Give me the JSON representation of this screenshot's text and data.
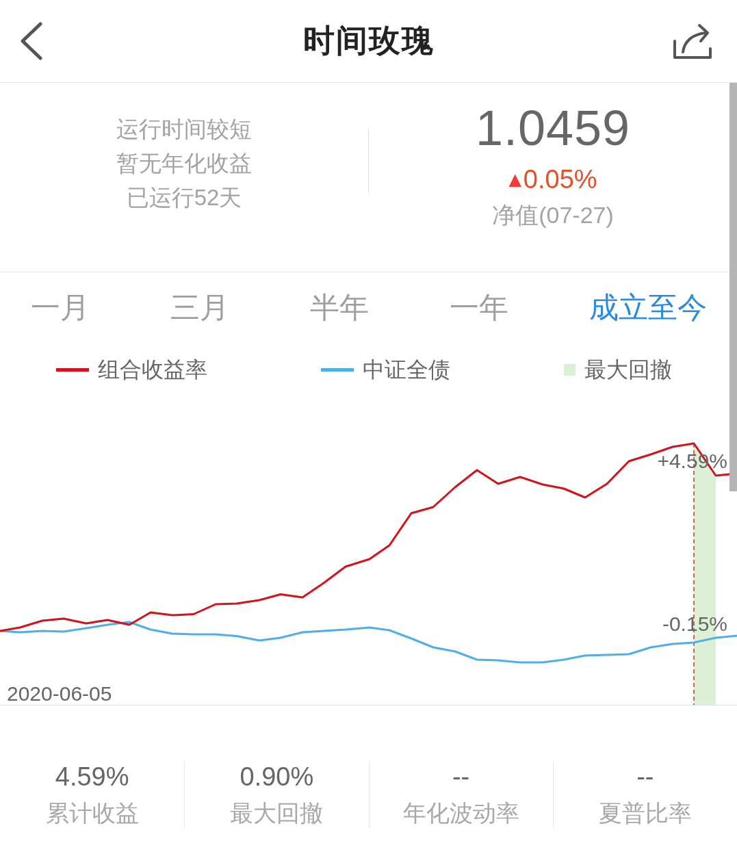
{
  "header": {
    "title": "时间玫瑰"
  },
  "summary": {
    "notes": [
      "运行时间较短",
      "暂无年化收益",
      "已运行52天"
    ],
    "nav": "1.0459",
    "change": {
      "arrow": "▲",
      "value": "0.05%"
    },
    "nav_label": "净值(07-27)"
  },
  "range_tabs": [
    {
      "label": "一月",
      "selected": false
    },
    {
      "label": "三月",
      "selected": false
    },
    {
      "label": "半年",
      "selected": false
    },
    {
      "label": "一年",
      "selected": false
    },
    {
      "label": "成立至今",
      "selected": true
    }
  ],
  "legend": [
    {
      "kind": "line",
      "label": "组合收益率",
      "color": "#d3121b"
    },
    {
      "kind": "line",
      "label": "中证全债",
      "color": "#4eaee8"
    },
    {
      "kind": "area",
      "label": "最大回撤",
      "color": "#dcf0d5"
    }
  ],
  "chart": {
    "start_date": "2020-06-05",
    "peak_label": "+4.59%",
    "benchmark_label": "-0.15%"
  },
  "stats": [
    {
      "value": "4.59%",
      "label": "累计收益"
    },
    {
      "value": "0.90%",
      "label": "最大回撤"
    },
    {
      "value": "--",
      "label": "年化波动率"
    },
    {
      "value": "--",
      "label": "夏普比率"
    }
  ]
}
